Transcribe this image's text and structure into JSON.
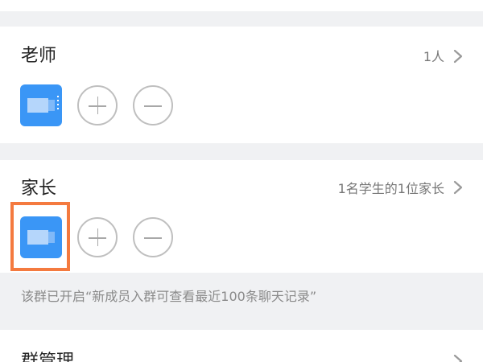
{
  "teachers": {
    "title": "老师",
    "count": "1人",
    "chevron_icon": "chevron-right-icon",
    "add_icon": "plus-icon",
    "remove_icon": "minus-icon",
    "avatar_color": "#3a96f6"
  },
  "parents": {
    "title": "家长",
    "count": "1名学生的1位家长",
    "chevron_icon": "chevron-right-icon",
    "add_icon": "plus-icon",
    "remove_icon": "minus-icon",
    "avatar_color": "#3a96f6",
    "highlight_color": "#f47a3f"
  },
  "notice": "该群已开启“新成员入群可查看最近100条聊天记录”",
  "group_management": {
    "title": "群管理",
    "chevron_icon": "chevron-right-icon"
  }
}
